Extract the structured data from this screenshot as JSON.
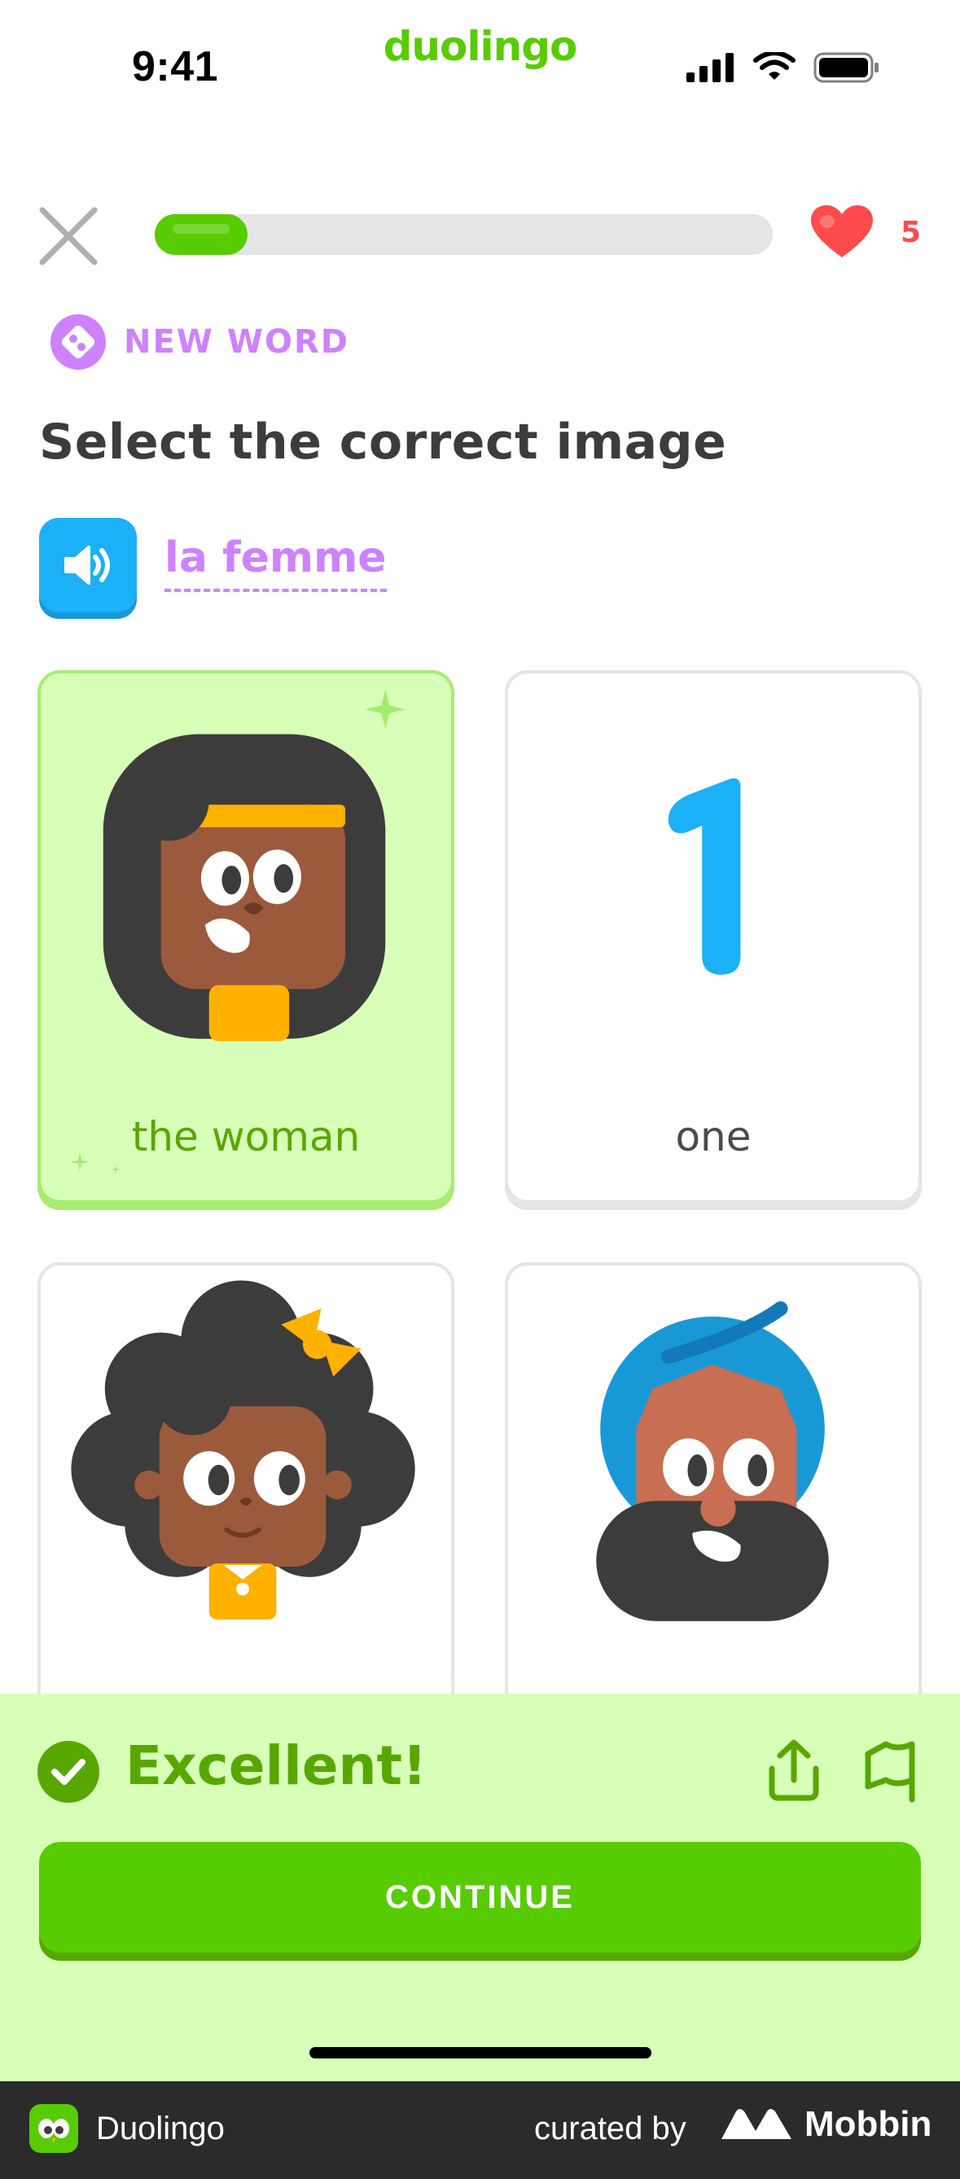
{
  "status_bar": {
    "time": "9:41",
    "brand": "duolingo"
  },
  "lesson": {
    "progress_fraction": 0.15,
    "hearts": "5"
  },
  "badge": {
    "label": "NEW WORD"
  },
  "prompt": {
    "title": "Select the correct image",
    "word": "la femme"
  },
  "choices": [
    {
      "label": "the woman",
      "selected": true,
      "art": "woman-face"
    },
    {
      "label": "one",
      "selected": false,
      "art": "numeral-one",
      "numeral": "1"
    },
    {
      "label": "",
      "selected": false,
      "art": "girl-face"
    },
    {
      "label": "",
      "selected": false,
      "art": "man-turban-face"
    }
  ],
  "feedback": {
    "title": "Excellent!",
    "continue_label": "CONTINUE"
  },
  "footer": {
    "app_name": "Duolingo",
    "curated_by": "curated by",
    "brand": "Mobbin"
  },
  "colors": {
    "green": "#58cc02",
    "green_dark": "#58a700",
    "green_light": "#d7ffb8",
    "purple": "#ce82ff",
    "blue": "#1cb0f6",
    "red": "#ff4b4b"
  },
  "icons": [
    "close-icon",
    "heart-icon",
    "speaker-icon",
    "check-icon",
    "share-icon",
    "flag-icon"
  ]
}
